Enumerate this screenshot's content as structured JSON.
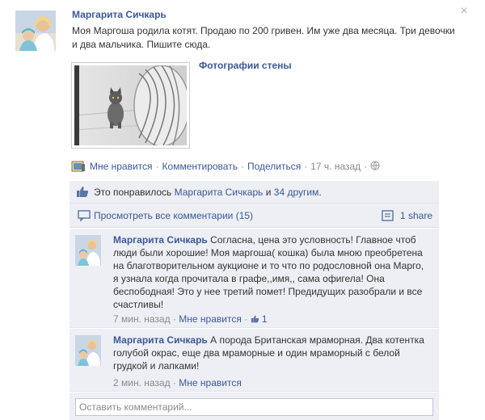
{
  "post": {
    "author": "Маргарита Сичкарь",
    "message": "Моя Маргоша родила котят. Продаю по 200 гривен. Им уже два месяца. Три девочки и два мальчика. Пишите сюда.",
    "album_link": "Фотографии стены",
    "close_glyph": "×"
  },
  "actions": {
    "like": "Мне нравится",
    "comment": "Комментировать",
    "share": "Поделиться",
    "time": "17 ч. назад",
    "sep": "·"
  },
  "likes": {
    "prefix": "Это понравилось",
    "name": "Маргарита Сичкарь",
    "conj": "и",
    "others": "34 другим",
    "suffix": "."
  },
  "view_all": {
    "label": "Просмотреть все комментарии (15)",
    "share_count": "1 share"
  },
  "comments": [
    {
      "author": "Маргарита Сичкарь",
      "text": "Согласна, цена это условность! Главное чтоб люди были хорошие! Моя маргоша( кошка) была мною преобретена на благотворительном аукционе и то что по родословной она Марго, я узнала когда прочитала в графе,,имя,, сама офигела! Она беспободная! Это у нее третий помет! Предидущих разобрали и все счастливы!",
      "time": "7 мин. назад",
      "like": "Мне нравится",
      "like_count": "1"
    },
    {
      "author": "Маргарита Сичкарь",
      "text": "А порода Британская мраморная. Два котентка голубой окрас, еще два мраморные и один мраморный с белой грудкой и лапками!",
      "time": "2 мин. назад",
      "like": "Мне нравится"
    }
  ],
  "input": {
    "placeholder": "Оставить комментарий..."
  },
  "icons": {
    "close": "close-icon",
    "like": "thumbs-up-icon",
    "comment": "comment-bubble-icon",
    "share": "share-icon",
    "globe": "globe-icon"
  },
  "colors": {
    "link": "#3b5998",
    "ufi_bg": "#edeff4",
    "meta": "#8a8a8a"
  }
}
